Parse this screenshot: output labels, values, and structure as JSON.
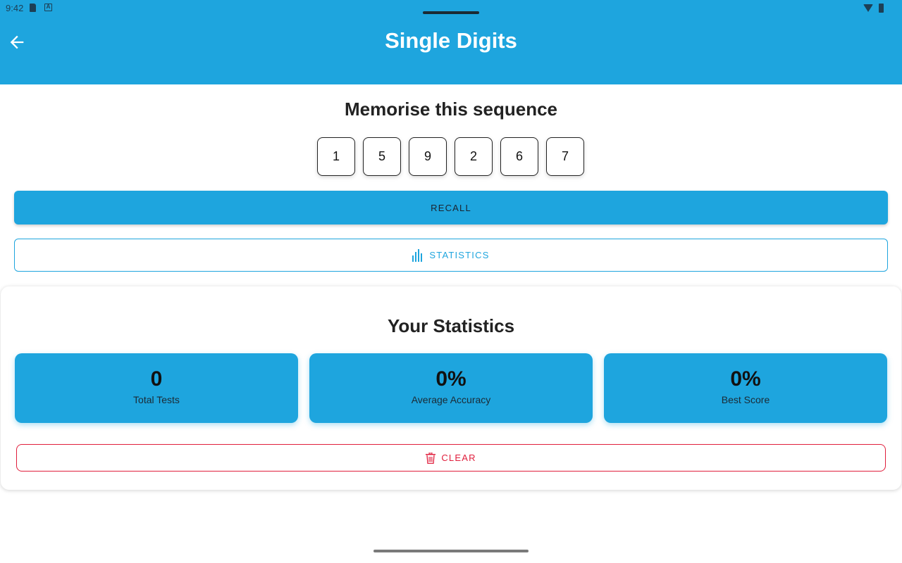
{
  "status_bar": {
    "time": "9:42",
    "left_icons": [
      "sd-card-icon",
      "a-notification-icon"
    ],
    "right_icons": [
      "wifi-icon",
      "battery-icon"
    ]
  },
  "appbar": {
    "title": "Single Digits",
    "back_icon": "arrow-left-icon"
  },
  "colors": {
    "primary": "#1ea5de",
    "danger": "#e01e3c",
    "text": "#222222"
  },
  "memorise": {
    "heading": "Memorise this sequence",
    "digits": [
      "1",
      "5",
      "9",
      "2",
      "6",
      "7"
    ]
  },
  "buttons": {
    "recall": "RECALL",
    "statistics": "STATISTICS",
    "statistics_icon": "bar-chart-icon"
  },
  "stats": {
    "title": "Your Statistics",
    "boxes": [
      {
        "value": "0",
        "label": "Total Tests"
      },
      {
        "value": "0%",
        "label": "Average Accuracy"
      },
      {
        "value": "0%",
        "label": "Best Score"
      }
    ],
    "clear": "CLEAR",
    "clear_icon": "trash-icon"
  }
}
